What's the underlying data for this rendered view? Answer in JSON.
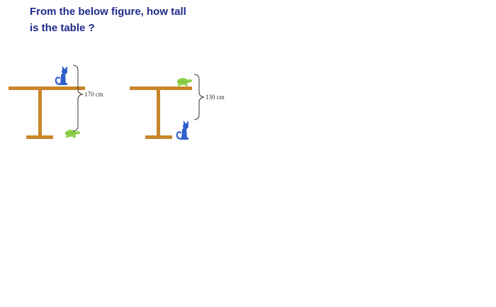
{
  "question": {
    "line1": "From the below figure, how tall",
    "line2": "is the table ?"
  },
  "figures": [
    {
      "top_animal": "cat",
      "bottom_animal": "turtle",
      "measurement": "170 cm"
    },
    {
      "top_animal": "turtle",
      "bottom_animal": "cat",
      "measurement": "130 cm"
    }
  ],
  "colors": {
    "text": "#1f2a8a",
    "table": "#c8862a",
    "cat": "#2f5fcc",
    "turtle": "#8fd14a",
    "bracket": "#333333"
  },
  "icons": [
    "cat-icon",
    "turtle-icon",
    "table-icon",
    "brace-icon"
  ]
}
